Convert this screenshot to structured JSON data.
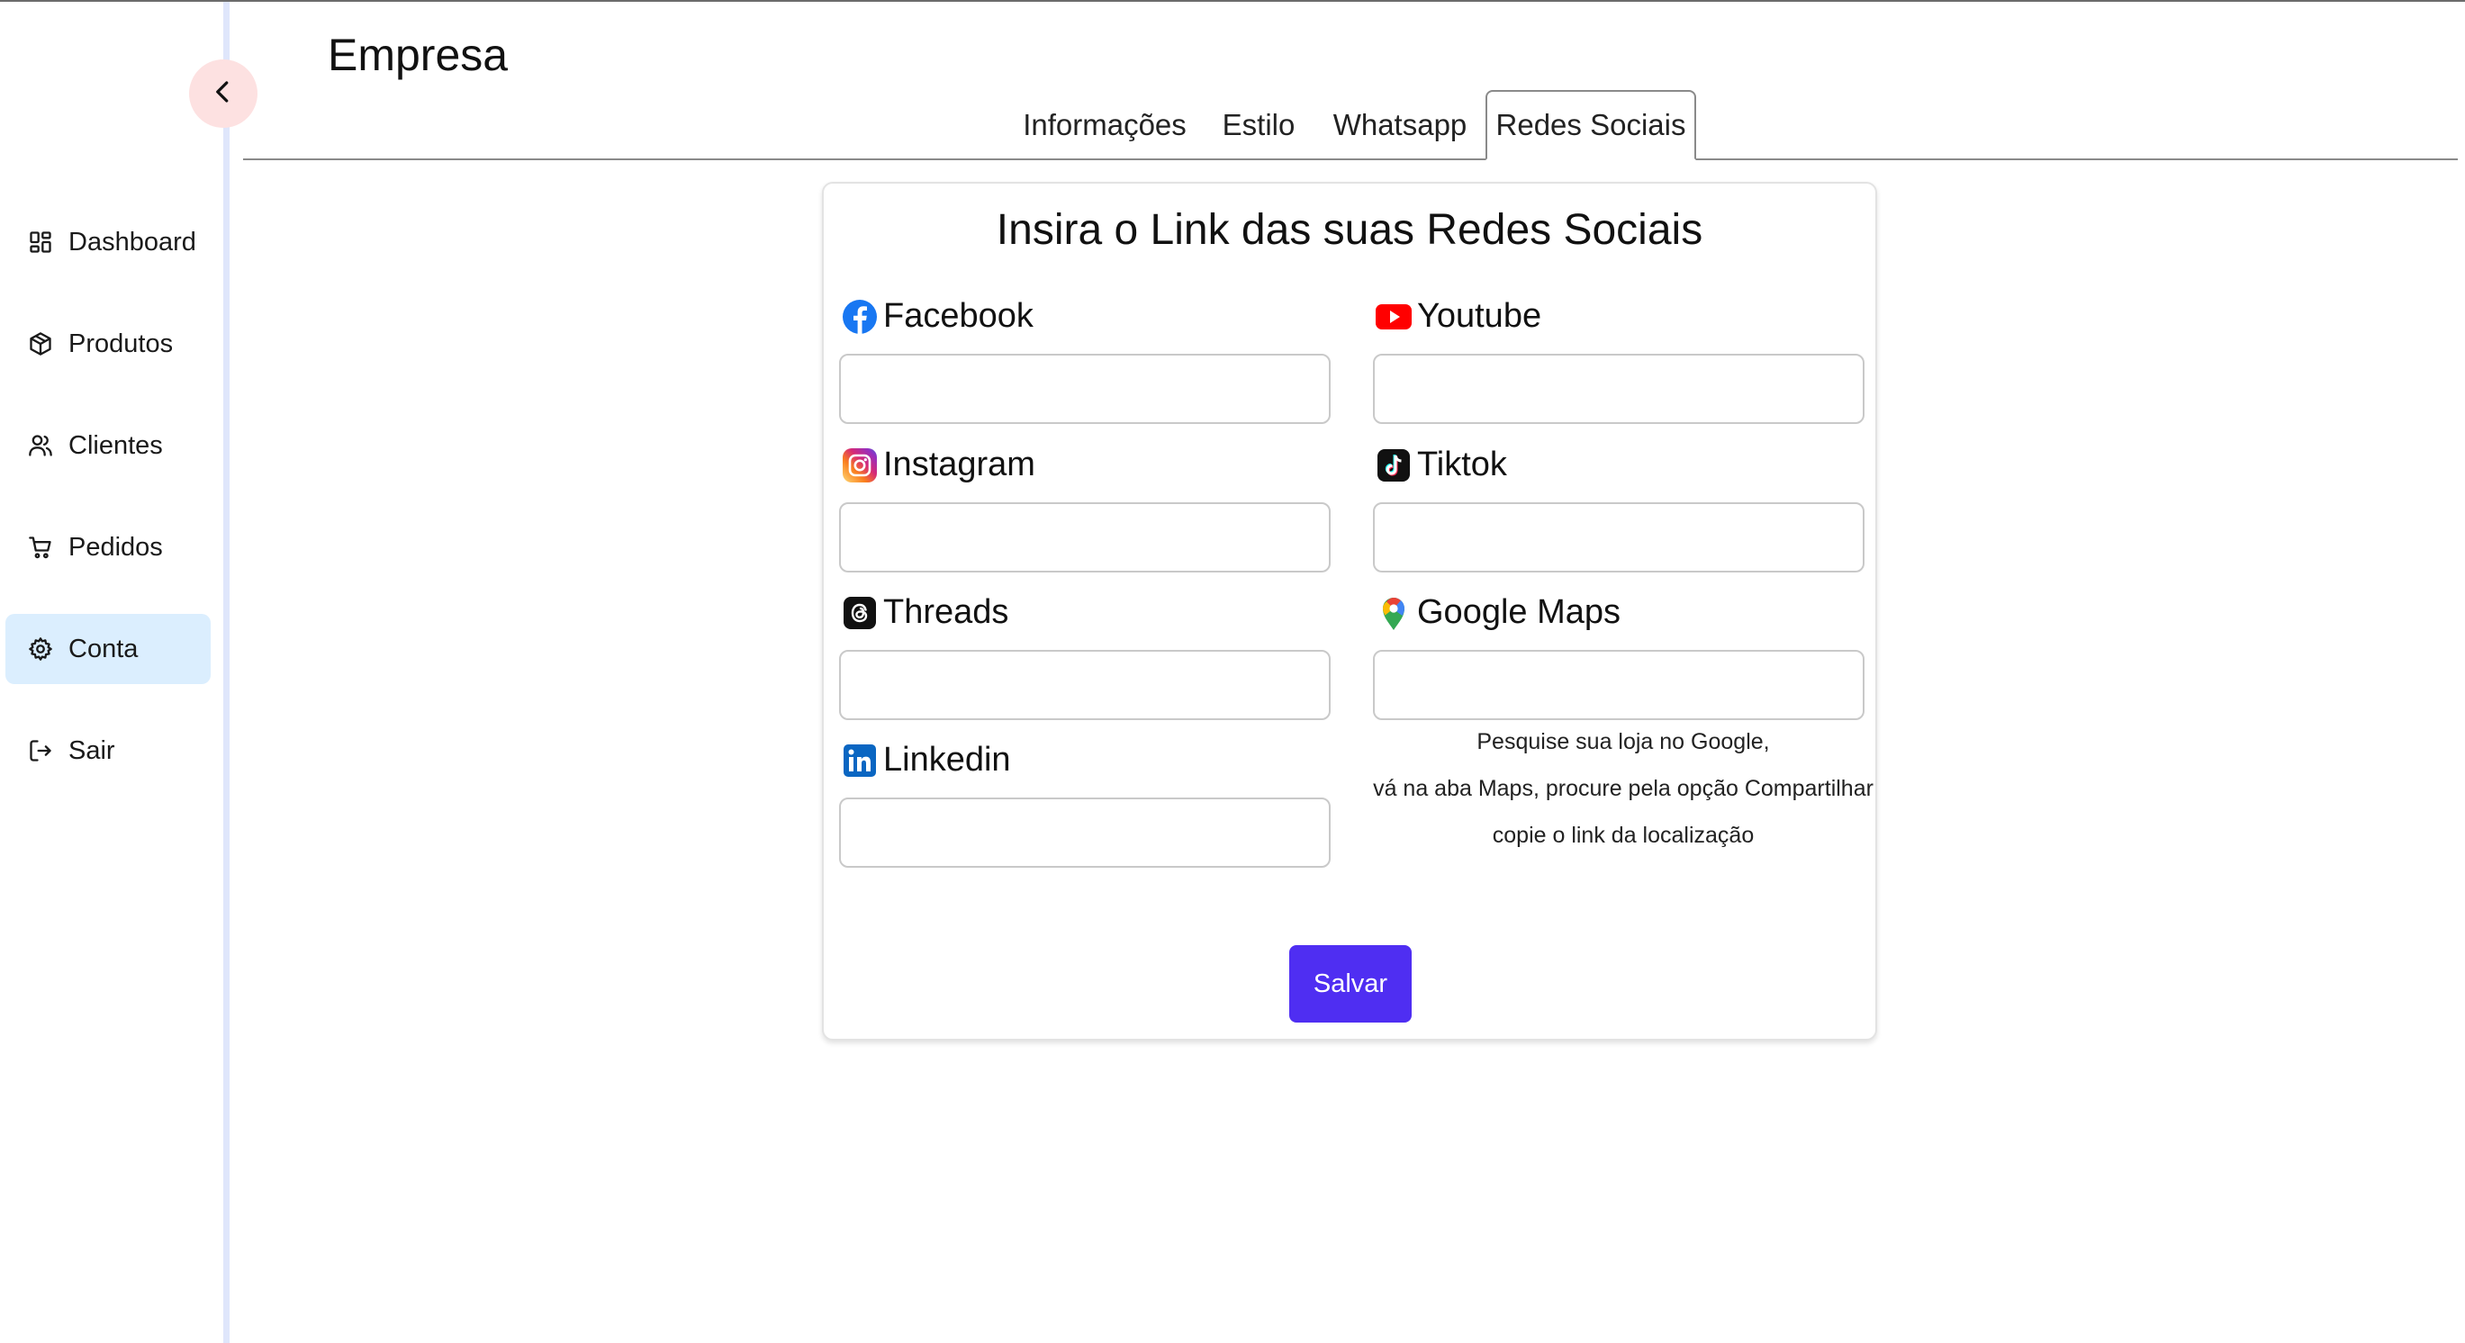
{
  "page": {
    "title": "Empresa"
  },
  "sidebar": {
    "items": [
      {
        "label": "Dashboard",
        "icon": "dashboard-icon",
        "active": false
      },
      {
        "label": "Produtos",
        "icon": "package-icon",
        "active": false
      },
      {
        "label": "Clientes",
        "icon": "users-icon",
        "active": false
      },
      {
        "label": "Pedidos",
        "icon": "cart-icon",
        "active": false
      },
      {
        "label": "Conta",
        "icon": "gear-icon",
        "active": true
      },
      {
        "label": "Sair",
        "icon": "logout-icon",
        "active": false
      }
    ]
  },
  "tabs": [
    {
      "label": "Informações",
      "active": false
    },
    {
      "label": "Estilo",
      "active": false
    },
    {
      "label": "Whatsapp",
      "active": false
    },
    {
      "label": "Redes Sociais",
      "active": true
    }
  ],
  "card": {
    "title": "Insira o Link das suas Redes Sociais",
    "fields": {
      "facebook": {
        "label": "Facebook",
        "value": "",
        "icon": "facebook-icon"
      },
      "youtube": {
        "label": "Youtube",
        "value": "",
        "icon": "youtube-icon"
      },
      "instagram": {
        "label": "Instagram",
        "value": "",
        "icon": "instagram-icon"
      },
      "tiktok": {
        "label": "Tiktok",
        "value": "",
        "icon": "tiktok-icon"
      },
      "threads": {
        "label": "Threads",
        "value": "",
        "icon": "threads-icon"
      },
      "google_maps": {
        "label": "Google Maps",
        "value": "",
        "icon": "google-maps-icon"
      },
      "linkedin": {
        "label": "Linkedin",
        "value": "",
        "icon": "linkedin-icon"
      }
    },
    "maps_hint": [
      "Pesquise sua loja no Google,",
      "vá na aba Maps, procure pela opção Compartilhar",
      "copie o link da localização"
    ],
    "save_label": "Salvar"
  },
  "colors": {
    "accent": "#4f2ef2",
    "active_nav_bg": "#dbeefe",
    "collapse_btn_bg": "#fde1e1",
    "sidebar_edge": "#dfe6fb"
  }
}
